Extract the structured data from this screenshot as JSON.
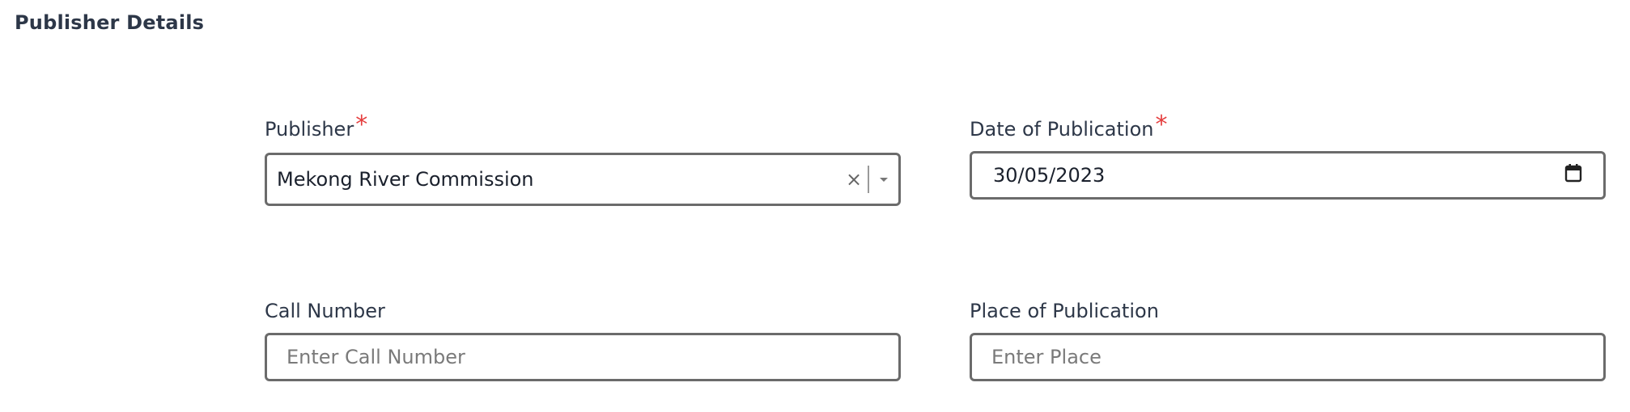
{
  "section": {
    "title": "Publisher Details"
  },
  "fields": {
    "publisher": {
      "label": "Publisher",
      "required_mark": "*",
      "value": "Mekong River Commission",
      "clear_glyph": "×"
    },
    "date_of_publication": {
      "label": "Date of Publication",
      "required_mark": "*",
      "value": "30/05/2023"
    },
    "call_number": {
      "label": "Call Number",
      "placeholder": "Enter Call Number"
    },
    "place_of_publication": {
      "label": "Place of Publication",
      "placeholder": "Enter Place"
    }
  },
  "icons": {
    "clear": "clear-icon",
    "dropdown": "chevron-down-icon",
    "calendar": "calendar-icon"
  },
  "colors": {
    "required": "#e53e3e",
    "border": "#6b6b6b",
    "text": "#2d3748"
  }
}
